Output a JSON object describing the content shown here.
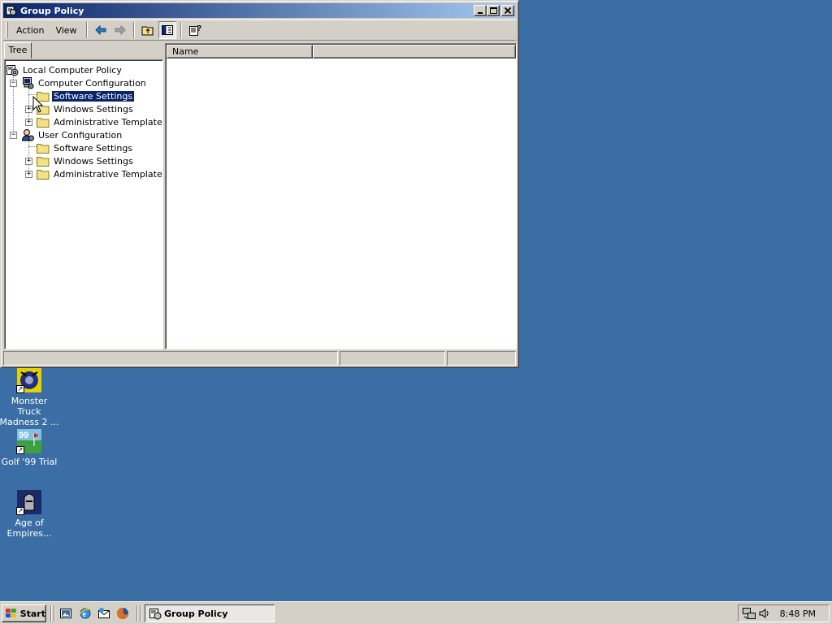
{
  "window": {
    "title": "Group Policy",
    "buttons": {
      "minimize": "_",
      "maximize": "□",
      "close": "×"
    }
  },
  "menu": {
    "action": "Action",
    "view": "View"
  },
  "tab": {
    "label": "Tree"
  },
  "tree": {
    "root": "Local Computer Policy",
    "computer_config": {
      "label": "Computer Configuration",
      "children": [
        "Software Settings",
        "Windows Settings",
        "Administrative Templates"
      ]
    },
    "user_config": {
      "label": "User Configuration",
      "children": [
        "Software Settings",
        "Windows Settings",
        "Administrative Templates"
      ]
    },
    "selected": "Software Settings"
  },
  "list": {
    "columns": [
      "Name",
      ""
    ]
  },
  "desktop": {
    "icons": [
      {
        "label_line1": "Monster Truck",
        "label_line2": "Madness 2 ..."
      },
      {
        "label_line1": "Golf '99 Trial",
        "label_line2": ""
      },
      {
        "label_line1": "Age of",
        "label_line2": "Empires..."
      }
    ]
  },
  "taskbar": {
    "start": "Start",
    "task": "Group Policy",
    "clock": "8:48 PM"
  },
  "colors": {
    "desktop": "#3a6ea5",
    "titlebar_start": "#0a246a",
    "titlebar_end": "#a6caf0",
    "face": "#d4d0c8",
    "selection": "#0a246a"
  }
}
